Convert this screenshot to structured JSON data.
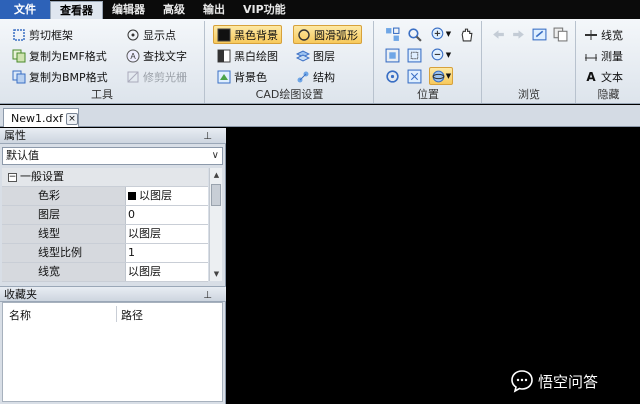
{
  "menubar": {
    "items": [
      "文件",
      "查看器",
      "编辑器",
      "高级",
      "输出",
      "VIP功能"
    ]
  },
  "ribbon": {
    "tools": {
      "label": "工具",
      "items": [
        "剪切框架",
        "复制为EMF格式",
        "复制为BMP格式",
        "显示点",
        "查找文字",
        "修剪光栅"
      ]
    },
    "cad": {
      "label": "CAD绘图设置",
      "items": [
        "黑色背景",
        "黑白绘图",
        "背景色",
        "圆滑弧形",
        "图层",
        "结构"
      ]
    },
    "position": {
      "label": "位置"
    },
    "browse": {
      "label": "浏览"
    },
    "hide": {
      "label": "隐藏",
      "items": [
        "线宽",
        "测量",
        "文本"
      ]
    }
  },
  "document_tab": {
    "name": "New1.dxf",
    "close": "×"
  },
  "properties_panel": {
    "title": "属性",
    "dropdown_value": "默认值",
    "category": "一般设置",
    "rows": [
      {
        "name": "色彩",
        "value": "以图层"
      },
      {
        "name": "图层",
        "value": "0"
      },
      {
        "name": "线型",
        "value": "以图层"
      },
      {
        "name": "线型比例",
        "value": "1"
      },
      {
        "name": "线宽",
        "value": "以图层"
      }
    ]
  },
  "favorites_panel": {
    "title": "收藏夹",
    "columns": [
      "名称",
      "路径"
    ]
  },
  "watermark": {
    "text": "悟空问答"
  },
  "colors": {
    "canvas": "#000000",
    "file_menu": "#2d62b8",
    "selected_button": "#f7c95c"
  }
}
